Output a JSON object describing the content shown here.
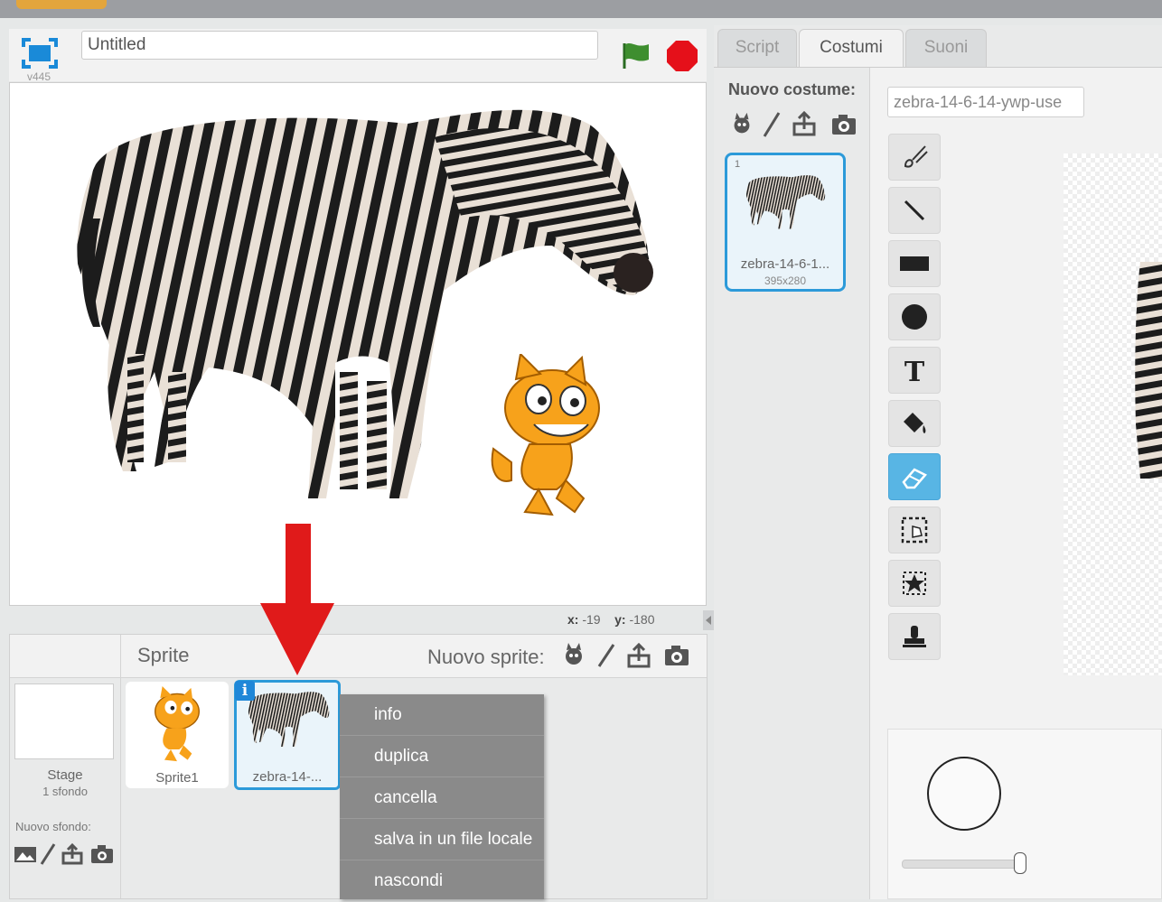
{
  "project": {
    "title": "Untitled",
    "version": "v445"
  },
  "stage": {
    "coords": {
      "x_label": "x:",
      "x_value": "-19",
      "y_label": "y:",
      "y_value": "-180"
    }
  },
  "sprite_pane": {
    "title": "Sprite",
    "new_sprite_label": "Nuovo sprite:",
    "stage_label": "Stage",
    "stage_backdrops": "1 sfondo",
    "new_backdrop_label": "Nuovo sfondo:",
    "sprites": [
      {
        "name": "Sprite1",
        "selected": false
      },
      {
        "name": "zebra-14-...",
        "selected": true,
        "info_badge": "i"
      }
    ]
  },
  "context_menu": {
    "items": [
      "info",
      "duplica",
      "cancella",
      "salva in un file locale",
      "nascondi"
    ]
  },
  "tabs": [
    {
      "label": "Script",
      "active": false
    },
    {
      "label": "Costumi",
      "active": true
    },
    {
      "label": "Suoni",
      "active": false
    }
  ],
  "costumes": {
    "new_costume_label": "Nuovo costume:",
    "list": [
      {
        "number": "1",
        "name": "zebra-14-6-1...",
        "size": "395x280",
        "selected": true
      }
    ],
    "current_name": "zebra-14-6-14-ywp-use"
  },
  "paint_tools": [
    "brush-icon",
    "line-icon",
    "rectangle-icon",
    "ellipse-icon",
    "text-icon",
    "fill-icon",
    "eraser-icon",
    "select-icon",
    "remove-background-icon",
    "stamp-icon"
  ],
  "active_tool": "eraser-icon",
  "colors": {
    "accent_blue": "#2c9ad9",
    "active_tool": "#58b5e4",
    "flag_green": "#3e8e2f",
    "stop_red": "#e5101a",
    "menu_gray": "#8a8a8a",
    "arrow_red": "#e01a1a"
  }
}
